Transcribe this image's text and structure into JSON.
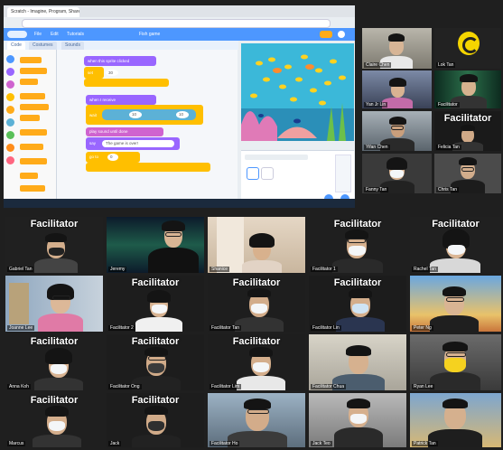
{
  "shared_screen": {
    "browser_tab": "Scratch - Imagine, Program, Share",
    "menu": [
      "File",
      "Edit",
      "Tutorials",
      "Fish game"
    ],
    "editor_tabs": [
      "Code",
      "Costumes",
      "Sounds"
    ],
    "blocks": {
      "b1": "when this sprite clicked",
      "b2": "set",
      "b2v": "30",
      "b3": "when I receive",
      "b4": "wait",
      "b4a": "10",
      "b4b": "10",
      "b5": "play sound until done",
      "b6": "say",
      "b6v": "The game is over!",
      "b7": "go to",
      "b7v": "0"
    }
  },
  "facilitator_label": "Facilitator",
  "side_panel": [
    {
      "name": "Claire Chen"
    },
    {
      "name": "Lok Tan"
    },
    {
      "name": "Yan Jr Lin"
    },
    {
      "name": "Facilitator"
    },
    {
      "name": "Yifan Chen"
    },
    {
      "name": "Felicia Tan"
    },
    {
      "name": "Fanny Tan"
    },
    {
      "name": "Chris Tan"
    }
  ],
  "gallery": [
    {
      "name": "Gabriel Tan"
    },
    {
      "name": "Jeremy"
    },
    {
      "name": "Shanice"
    },
    {
      "name": "Facilitator 1"
    },
    {
      "name": "Rachel Tan"
    },
    {
      "name": "Joanne Lee"
    },
    {
      "name": "Facilitator 2"
    },
    {
      "name": "Facilitator Tan"
    },
    {
      "name": "Facilitator Lin"
    },
    {
      "name": "Peter Ng"
    },
    {
      "name": "Anna Koh"
    },
    {
      "name": "Facilitator Ong"
    },
    {
      "name": "Facilitator Lim"
    },
    {
      "name": "Facilitator Chua"
    },
    {
      "name": "Ryan Lee"
    },
    {
      "name": "Marcus"
    },
    {
      "name": "Jack"
    },
    {
      "name": "Facilitator Ho"
    },
    {
      "name": "Jack Teo"
    },
    {
      "name": "Patrick Tan"
    }
  ]
}
